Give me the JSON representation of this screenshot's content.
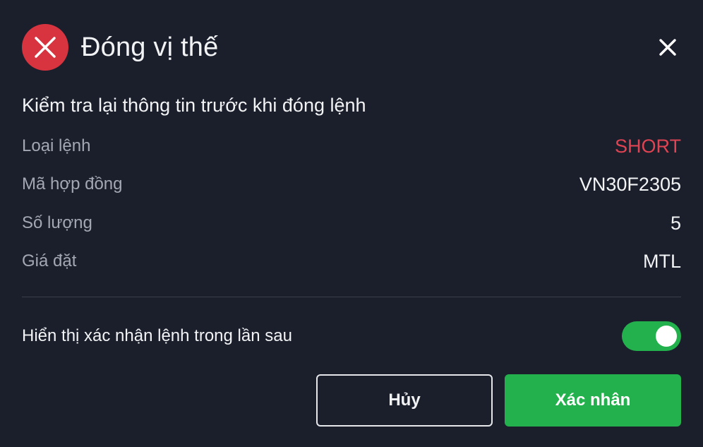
{
  "dialog": {
    "title": "Đóng vị thế",
    "header_icon": "x-circle-icon",
    "close_icon": "close-icon",
    "subtitle": "Kiểm tra lại thông tin trước khi đóng lệnh",
    "rows": [
      {
        "label": "Loại lệnh",
        "value": "SHORT"
      },
      {
        "label": "Mã hợp đồng",
        "value": "VN30F2305"
      },
      {
        "label": "Số lượng",
        "value": "5"
      },
      {
        "label": "Giá đặt",
        "value": "MTL"
      }
    ],
    "toggle": {
      "label": "Hiển thị xác nhận lệnh trong lần sau",
      "enabled": true
    },
    "buttons": {
      "cancel_label": "Hủy",
      "confirm_label": "Xác nhân"
    }
  },
  "colors": {
    "background": "#1b1e2b",
    "danger": "#d8343f",
    "short_value": "#e04452",
    "primary_green": "#22b14c",
    "label_gray": "#a4a8b3"
  }
}
